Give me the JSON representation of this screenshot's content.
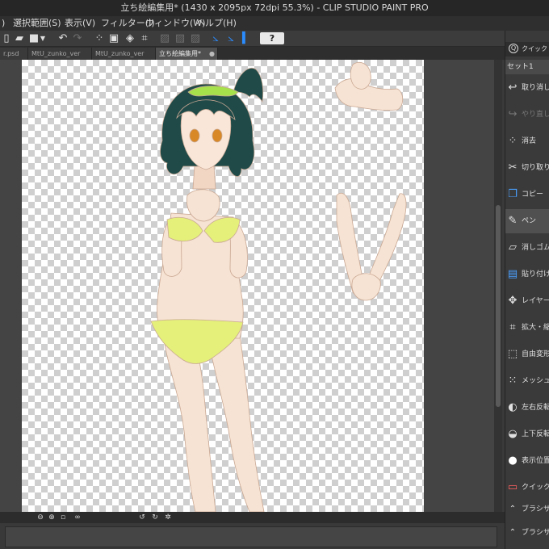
{
  "window": {
    "title": "立ち絵編集用* (1430 x 2095px 72dpi 55.3%) - CLIP STUDIO PAINT PRO"
  },
  "menu": [
    "選択範囲(S)",
    "表示(V)",
    "フィルター(I)",
    "ウィンドウ(W)",
    "ヘルプ(H)"
  ],
  "toolbar": {
    "help_label": "?"
  },
  "tabs": [
    {
      "label": "r.psd",
      "active": false
    },
    {
      "label": "MtU_zunko_ver",
      "active": false
    },
    {
      "label": "MtU_zunko_ver",
      "active": false
    },
    {
      "label": "立ち絵編集用*",
      "active": true
    }
  ],
  "quick_access": {
    "header": "クイック",
    "set_name": "セット1",
    "items": [
      {
        "label": "取り消し",
        "icon": "undo-icon",
        "enabled": true
      },
      {
        "label": "やり直し",
        "icon": "redo-icon",
        "enabled": false
      },
      {
        "label": "消去",
        "icon": "clear-icon",
        "enabled": true
      },
      {
        "label": "切り取り",
        "icon": "scissors-icon",
        "enabled": true
      },
      {
        "label": "コピー",
        "icon": "copy-icon",
        "enabled": true
      },
      {
        "label": "ペン",
        "icon": "pen-icon",
        "enabled": true
      },
      {
        "label": "消しゴム",
        "icon": "eraser-icon",
        "enabled": true
      },
      {
        "label": "貼り付け",
        "icon": "paste-icon",
        "enabled": true
      },
      {
        "label": "レイヤー移",
        "icon": "layer-move-icon",
        "enabled": true
      },
      {
        "label": "拡大・縮",
        "icon": "scale-icon",
        "enabled": true
      },
      {
        "label": "自由変形",
        "icon": "free-transform-icon",
        "enabled": true
      },
      {
        "label": "メッシュ変",
        "icon": "mesh-transform-icon",
        "enabled": true
      },
      {
        "label": "左右反転",
        "icon": "flip-horizontal-icon",
        "enabled": true
      },
      {
        "label": "上下反転",
        "icon": "flip-vertical-icon",
        "enabled": true
      },
      {
        "label": "表示位置",
        "icon": "reset-view-icon",
        "enabled": true
      },
      {
        "label": "クイックマス",
        "icon": "quick-mask-icon",
        "enabled": true
      },
      {
        "label": "ブラシサイ",
        "icon": "brush-size-up-icon",
        "enabled": true
      },
      {
        "label": "ブラシサイ",
        "icon": "brush-size-down-icon",
        "enabled": true
      }
    ]
  },
  "colors": {
    "accent": "#2b8cff",
    "bg": "#3a3a3a",
    "hair": "#1f4a48",
    "skin": "#f7e3d3",
    "headband": "#a6e04a",
    "bikini": "#e4f07a"
  }
}
